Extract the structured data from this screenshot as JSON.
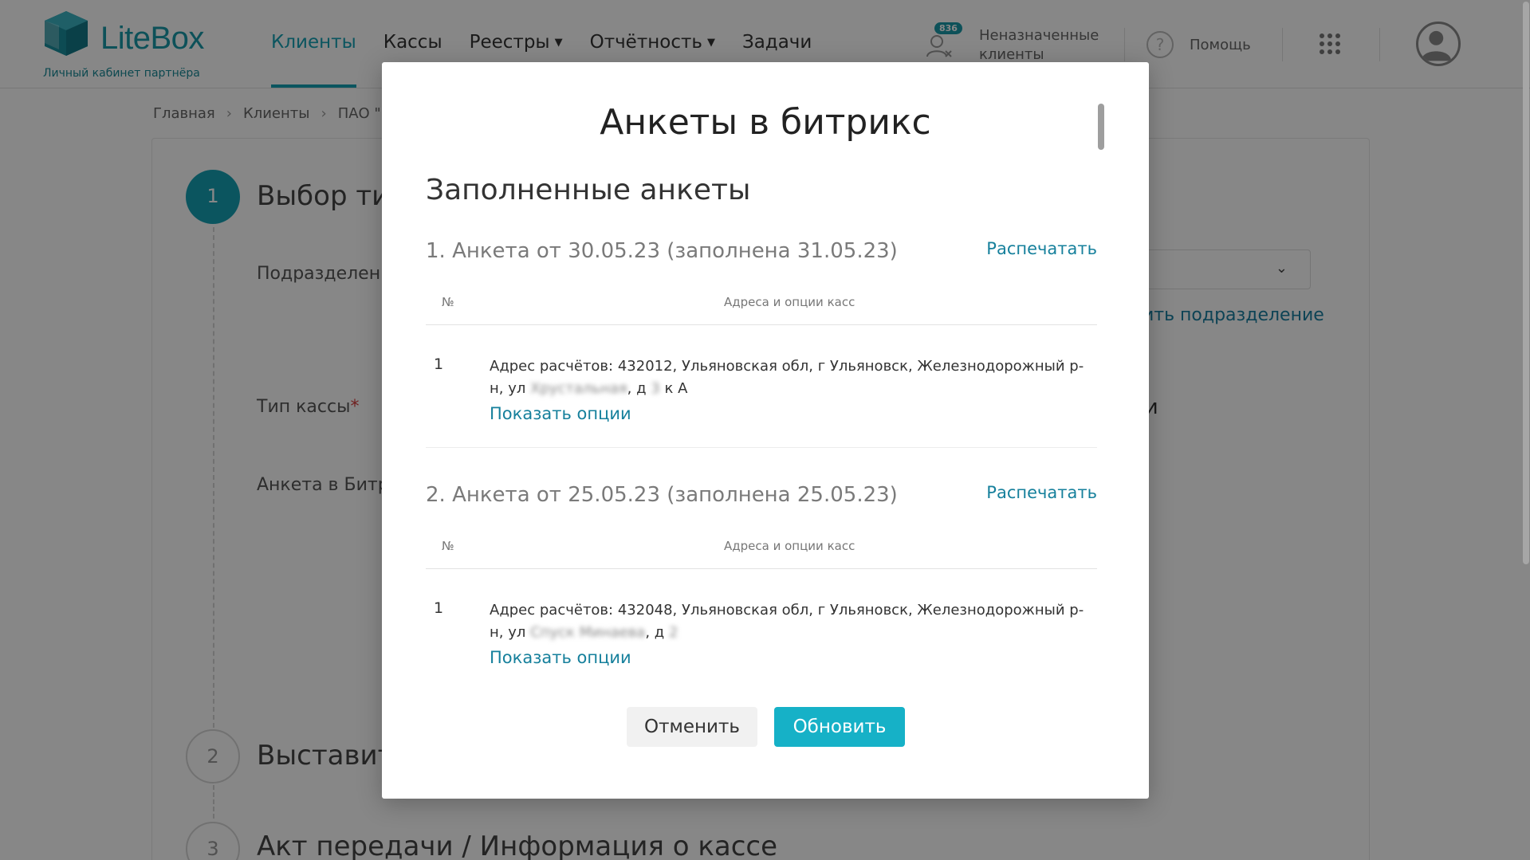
{
  "header": {
    "logo_text": "LiteBox",
    "logo_sub": "Личный кабинет партнёра",
    "nav": [
      {
        "label": "Клиенты",
        "dropdown": false,
        "active": true
      },
      {
        "label": "Кассы",
        "dropdown": false,
        "active": false
      },
      {
        "label": "Реестры",
        "dropdown": true,
        "active": false
      },
      {
        "label": "Отчётность",
        "dropdown": true,
        "active": false
      },
      {
        "label": "Задачи",
        "dropdown": false,
        "active": false
      }
    ],
    "unassigned": {
      "badge": "836",
      "line1": "Неназначенные",
      "line2": "клиенты"
    },
    "help_icon": "?",
    "help_label": "Помощь"
  },
  "breadcrumb": [
    "Главная",
    "Клиенты",
    "ПАО \"МА"
  ],
  "background": {
    "steps": [
      {
        "num": "1",
        "title": "Выбор тип"
      },
      {
        "num": "2",
        "title": "Выставить"
      },
      {
        "num": "3",
        "title": "Акт передачи / Информация о кассе"
      }
    ],
    "fields": {
      "division": "Подразделение",
      "cash_type": "Тип кассы",
      "required_mark": "*",
      "bitrix_form": "Анкета в Битри"
    },
    "add_division_link": "вить подразделение",
    "partial_text": "ки"
  },
  "modal": {
    "title": "Анкеты в битрикс",
    "section_title": "Заполненные анкеты",
    "forms": [
      {
        "heading": "1. Анкета от 30.05.23 (заполнена 31.05.23)",
        "print_label": "Распечатать",
        "col_num": "№",
        "col_addr": "Адреса и опции касс",
        "row_num": "1",
        "addr_main": "Адрес расчётов: 432012, Ульяновская обл, г Ульяновск, Железнодорожный р-н, ул",
        "addr_blur_street": "Хрустальная",
        "addr_mid": ", д ",
        "addr_blur_house": "3",
        "addr_tail": " к А",
        "show_options": "Показать опции"
      },
      {
        "heading": "2. Анкета от 25.05.23 (заполнена 25.05.23)",
        "print_label": "Распечатать",
        "col_num": "№",
        "col_addr": "Адреса и опции касс",
        "row_num": "1",
        "addr_main": "Адрес расчётов: 432048, Ульяновская обл, г Ульяновск, Железнодорожный р-н, ул",
        "addr_blur_street": "Спуск Минаева",
        "addr_mid": ", д ",
        "addr_blur_house": "2",
        "addr_tail": "",
        "show_options": "Показать опции"
      }
    ],
    "cancel_label": "Отменить",
    "update_label": "Обновить"
  },
  "colors": {
    "accent": "#16a0b4",
    "primary_button": "#16b1c7",
    "link": "#16809c"
  },
  "icons": {
    "nav_dropdown": "caret-down-icon",
    "unassigned": "unassigned-user-icon",
    "help": "help-circle-icon",
    "apps": "apps-grid-icon",
    "avatar": "user-avatar-icon",
    "breadcrumb_separator": "chevron-right-icon",
    "select": "chevron-down-icon"
  }
}
